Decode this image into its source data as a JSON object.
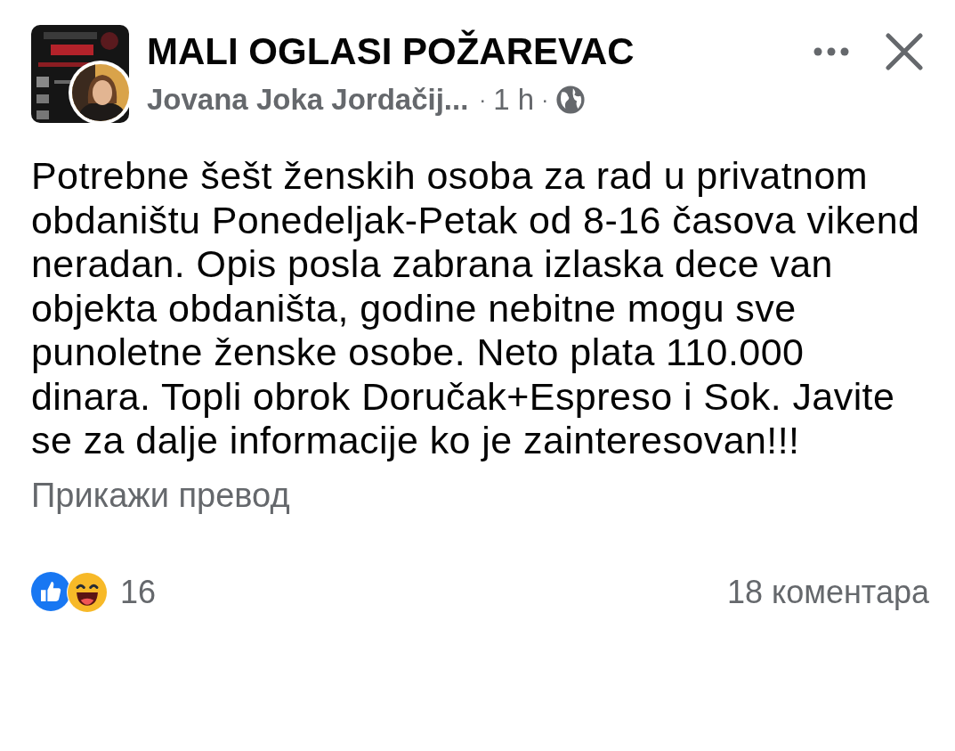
{
  "post": {
    "group_name": "MALI OGLASI POŽAREVAC",
    "author": "Jovana Joka Jordačij...",
    "separator_1": "·",
    "time": "1 h",
    "separator_2": "·",
    "body": "Potrebne šešt ženskih osoba za rad u privatnom obdaništu Ponedeljak-Petak od 8-16 časova vikend neradan. Opis posla zabrana izlaska dece van objekta obdaništa, godine nebitne mogu sve punoletne ženske osobe. Neto plata 110.000 dinara. Topli obrok Doručak+Espreso i Sok. Javite se za dalje informacije ko je zainteresovan!!!",
    "translate_link": "Прикажи превод",
    "reactions": [
      {
        "kind": "like"
      },
      {
        "kind": "haha"
      }
    ],
    "reaction_count": "16",
    "comments": "18 коментара"
  }
}
